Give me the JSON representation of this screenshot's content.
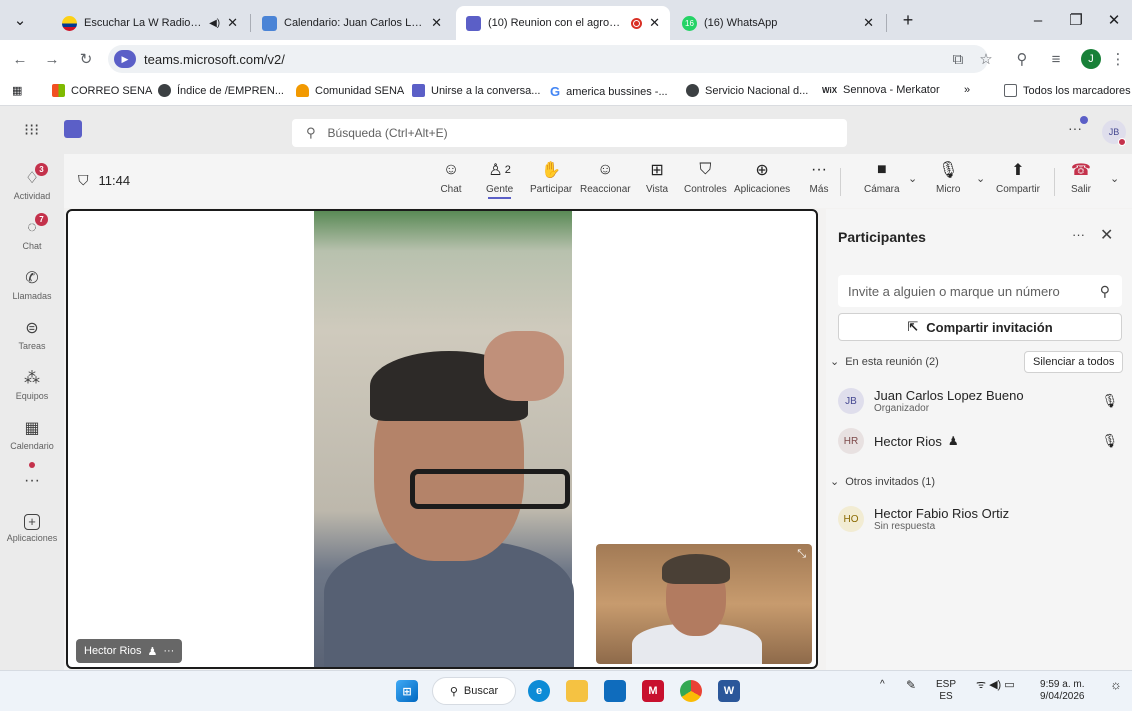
{
  "browser": {
    "tabs": [
      {
        "title": "Escuchar La W Radio en vivo",
        "audio": "◀)",
        "active": false
      },
      {
        "title": "Calendario: Juan Carlos Lopez Bueno",
        "active": false
      },
      {
        "title": "(10) Reunion con el agronomo",
        "active": true
      },
      {
        "title": "(16) WhatsApp",
        "active": false
      }
    ],
    "whatsapp_badge": "16",
    "url": "teams.microsoft.com/v2/",
    "profile_initial": "J",
    "bookmarks": [
      {
        "label": "CORREO SENA"
      },
      {
        "label": "Índice de /EMPREN..."
      },
      {
        "label": "Comunidad SENA"
      },
      {
        "label": "Unirse a la conversa..."
      },
      {
        "label": "america bussines -..."
      },
      {
        "label": "Servicio Nacional d..."
      },
      {
        "label": "Sennova - Merkator"
      },
      {
        "label": "Todos los marcadores"
      }
    ],
    "bookmarks_overflow": "»"
  },
  "teams": {
    "search_placeholder": "Búsqueda (Ctrl+Alt+E)",
    "user_initials": "JB",
    "rail": [
      {
        "label": "Actividad",
        "badge": "3"
      },
      {
        "label": "Chat",
        "badge": "7"
      },
      {
        "label": "Llamadas"
      },
      {
        "label": "Tareas"
      },
      {
        "label": "Equipos"
      },
      {
        "label": "Calendario"
      },
      {
        "label": "Aplicaciones"
      }
    ],
    "meeting_time": "11:44",
    "people_count": "2",
    "toolbar": {
      "chat": "Chat",
      "people": "Gente",
      "raise": "Participar",
      "react": "Reaccionar",
      "view": "Vista",
      "controls": "Controles",
      "apps": "Aplicaciones",
      "more": "Más",
      "camera": "Cámara",
      "mic": "Micro",
      "share": "Compartir",
      "leave": "Salir"
    },
    "stage": {
      "main_speaker": "Hector Rios",
      "name_more": "···"
    },
    "panel": {
      "title": "Participantes",
      "invite_placeholder": "Invite a alguien o marque un número",
      "share_invite": "Compartir invitación",
      "in_meeting_section": "En esta reunión (2)",
      "mute_all": "Silenciar a todos",
      "others_section": "Otros invitados (1)",
      "in_meeting": [
        {
          "initials": "JB",
          "name": "Juan Carlos Lopez Bueno",
          "role": "Organizador"
        },
        {
          "initials": "HR",
          "name": "Hector Rios",
          "role": ""
        }
      ],
      "others": [
        {
          "initials": "HO",
          "name": "Hector Fabio Rios Ortiz",
          "role": "Sin respuesta"
        }
      ]
    }
  },
  "taskbar": {
    "search_label": "Buscar",
    "lang_top": "ESP",
    "lang_bottom": "ES",
    "time": "9:59 a. m.",
    "date": "9/04/2026"
  },
  "colors": {
    "teams_accent": "#5b5fc7",
    "leave_red": "#c4314b",
    "badge_red": "#c4314b"
  }
}
